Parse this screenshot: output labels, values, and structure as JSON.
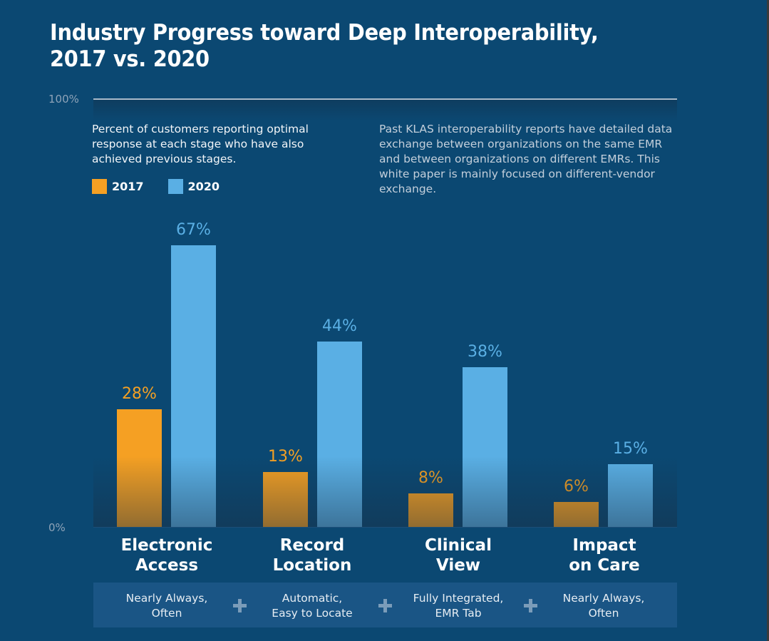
{
  "title": "Industry Progress toward Deep Interoperability, 2017 vs. 2020",
  "subtitle": "Percent of customers reporting optimal response at each stage who have also achieved previous stages.",
  "note": "Past KLAS interoperability reports have detailed data exchange between organizations on the same EMR and between organizations on different EMRs. This white paper is mainly focused on different-vendor exchange.",
  "colors": {
    "background": "#0b4872",
    "series_2017": "#f5a023",
    "series_2020": "#5aafe4",
    "band": "#1a5585"
  },
  "chart_data": {
    "type": "bar",
    "title": "Industry Progress toward Deep Interoperability, 2017 vs. 2020",
    "xlabel": "",
    "ylabel": "",
    "ylim": [
      0,
      100
    ],
    "y_tick_labels": [
      "0%",
      "100%"
    ],
    "grid": false,
    "legend": {
      "placement": "top-left",
      "entries": [
        "2017",
        "2020"
      ]
    },
    "categories": [
      "Electronic Access",
      "Record Location",
      "Clinical View",
      "Impact on Care"
    ],
    "category_descriptions": [
      "Nearly Always, Often",
      "Automatic, Easy to Locate",
      "Fully Integrated, EMR Tab",
      "Nearly Always, Often"
    ],
    "series": [
      {
        "name": "2017",
        "color": "#f5a023",
        "values": [
          28,
          13,
          8,
          6
        ],
        "labels": [
          "28%",
          "13%",
          "8%",
          "6%"
        ]
      },
      {
        "name": "2020",
        "color": "#5aafe4",
        "values": [
          67,
          44,
          38,
          15
        ],
        "labels": [
          "67%",
          "44%",
          "38%",
          "15%"
        ]
      }
    ]
  },
  "categories_display": [
    {
      "line1": "Electronic",
      "line2": "Access",
      "desc1": "Nearly Always,",
      "desc2": "Often"
    },
    {
      "line1": "Record",
      "line2": "Location",
      "desc1": "Automatic,",
      "desc2": "Easy to Locate"
    },
    {
      "line1": "Clinical",
      "line2": "View",
      "desc1": "Fully Integrated,",
      "desc2": "EMR Tab"
    },
    {
      "line1": "Impact",
      "line2": "on Care",
      "desc1": "Nearly Always,",
      "desc2": "Often"
    }
  ]
}
